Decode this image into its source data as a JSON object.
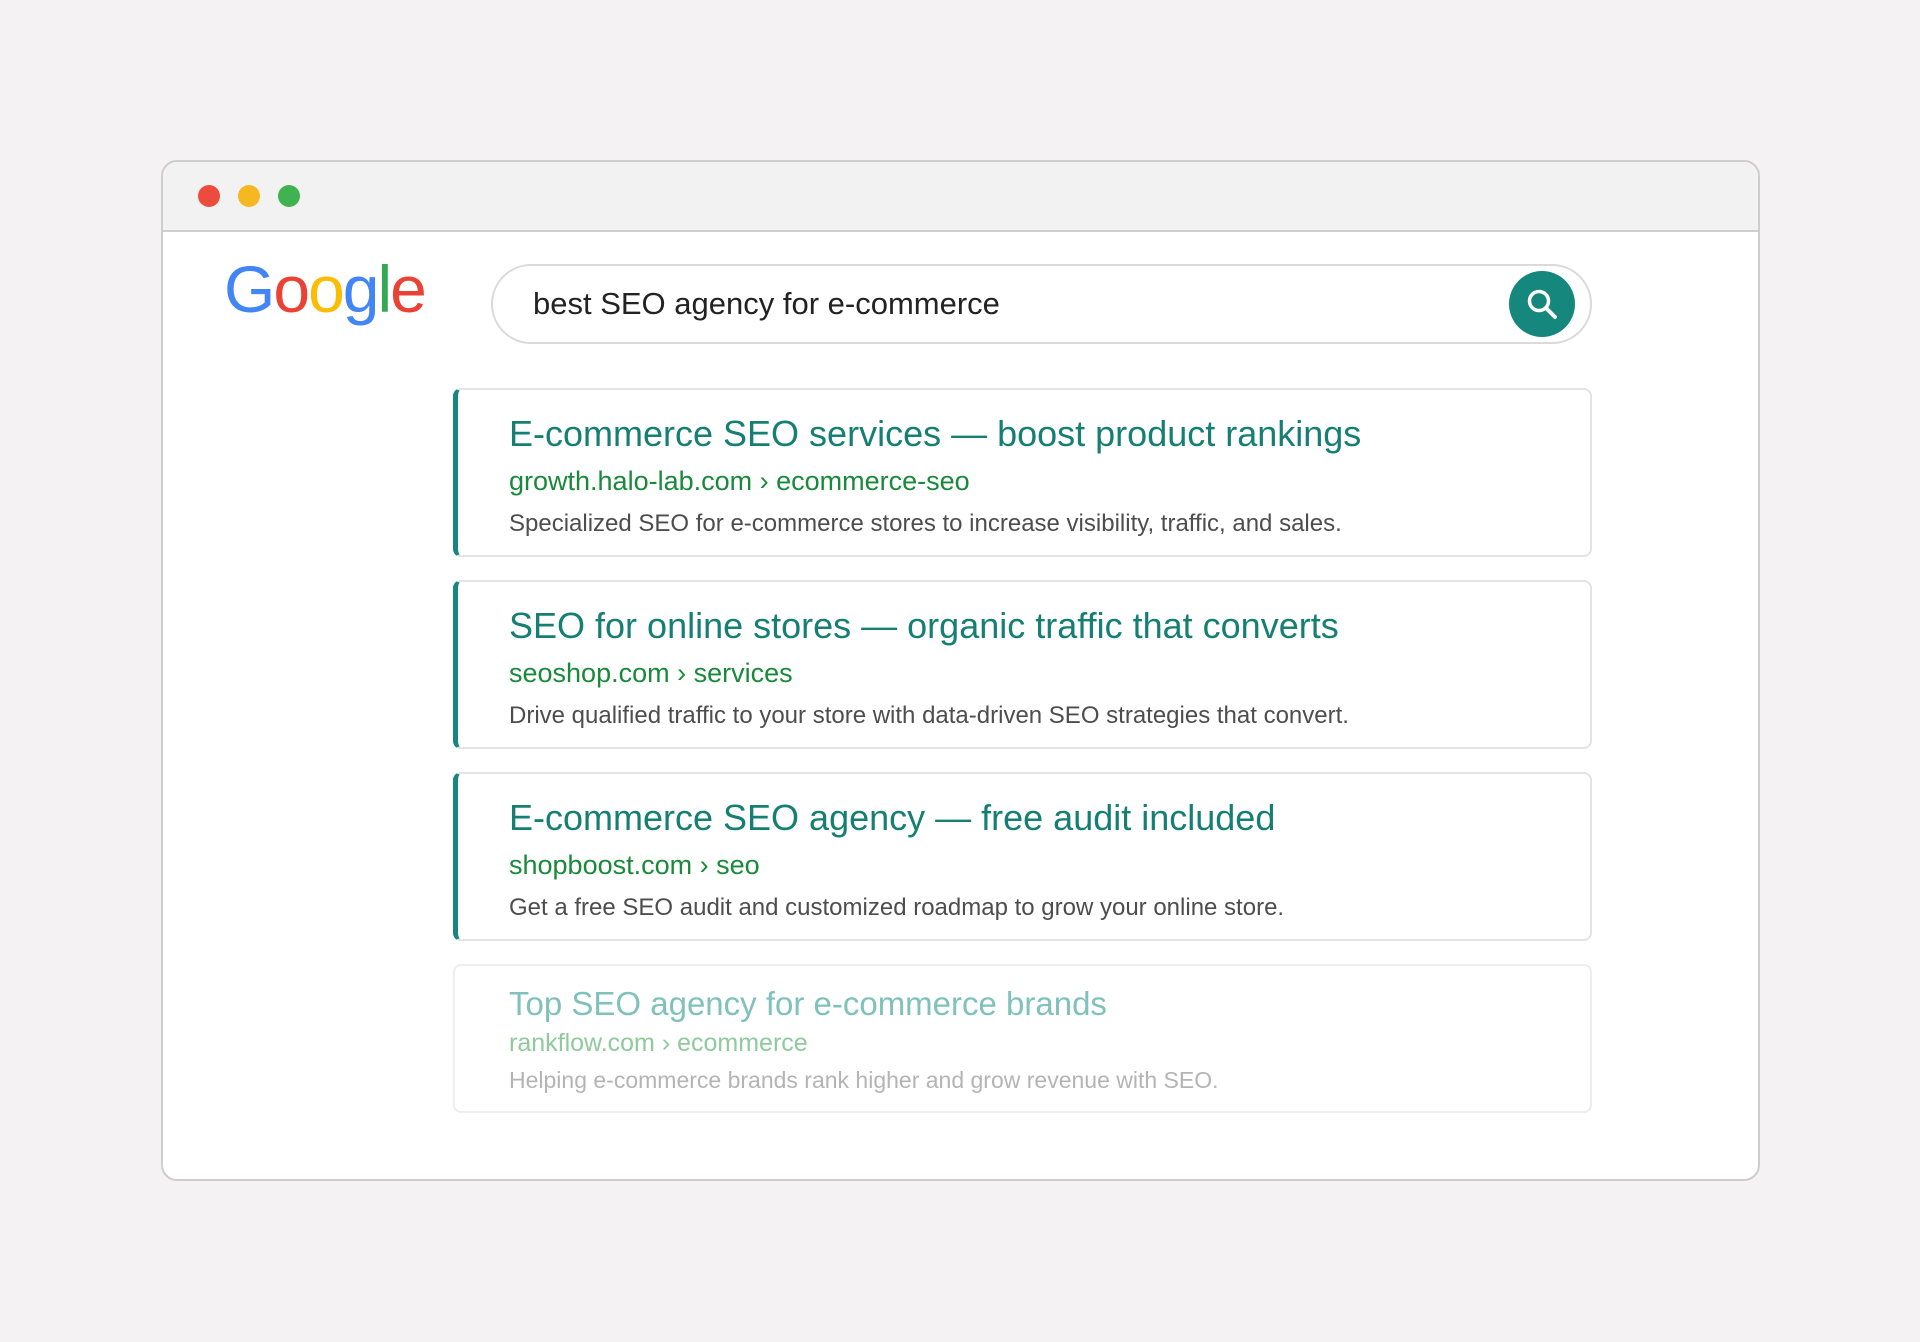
{
  "window": {
    "controls": [
      "close",
      "minimize",
      "maximize"
    ]
  },
  "logo": {
    "letters": [
      {
        "char": "G",
        "color": "#4285f4"
      },
      {
        "char": "o",
        "color": "#ea4335"
      },
      {
        "char": "o",
        "color": "#fbbc05"
      },
      {
        "char": "g",
        "color": "#4285f4"
      },
      {
        "char": "l",
        "color": "#34a853"
      },
      {
        "char": "e",
        "color": "#ea4335"
      }
    ]
  },
  "search": {
    "query": "best SEO agency for e-commerce",
    "button_icon": "search-icon"
  },
  "results": [
    {
      "title": "E-commerce SEO services — boost product rankings",
      "url": "growth.halo-lab.com › ecommerce-seo",
      "description": "Specialized SEO for e-commerce stores to increase visibility, traffic, and sales."
    },
    {
      "title": "SEO for online stores — organic traffic that converts",
      "url": "seoshop.com › services",
      "description": "Drive qualified traffic to your store with data-driven SEO strategies that convert."
    },
    {
      "title": "E-commerce SEO agency — free audit included",
      "url": "shopboost.com › seo",
      "description": "Get a free SEO audit and customized roadmap to grow your online store."
    },
    {
      "title": "Top SEO agency for e-commerce brands",
      "url": "rankflow.com › ecommerce",
      "description": "Helping e-commerce brands rank higher and grow revenue with SEO."
    }
  ],
  "colors": {
    "accent": "#16877c",
    "title": "#157f74",
    "url": "#188a3a",
    "description": "#4d4d4d"
  }
}
